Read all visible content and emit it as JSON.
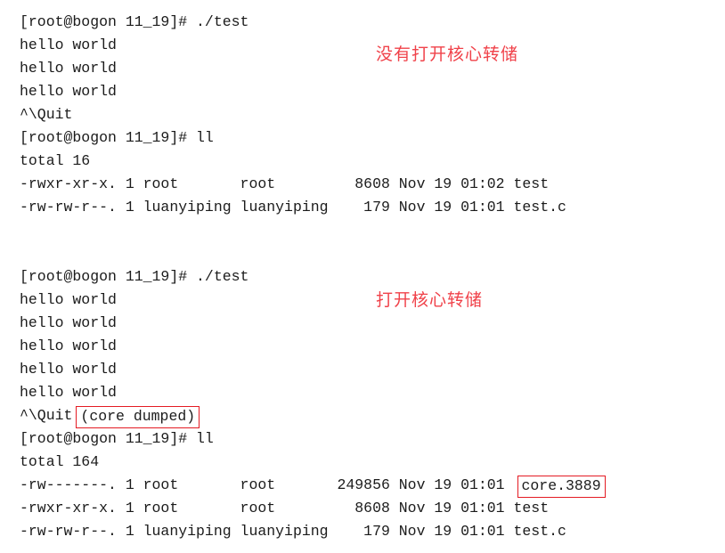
{
  "terminal": {
    "prompt": "[root@bogon 11_19]# ",
    "blocks": [
      {
        "id": "without-core-dump",
        "lines": [
          {
            "type": "prompt",
            "text": "[root@bogon 11_19]# ./test"
          },
          {
            "type": "output",
            "text": "hello world"
          },
          {
            "type": "output",
            "text": "hello world"
          },
          {
            "type": "output",
            "text": "hello world"
          },
          {
            "type": "signal",
            "text": "^\\Quit"
          },
          {
            "type": "prompt",
            "text": "[root@bogon 11_19]# ll"
          },
          {
            "type": "output",
            "text": "total 16"
          },
          {
            "type": "listing",
            "text": "-rwxr-xr-x. 1 root       root         8608 Nov 19 01:02 test"
          },
          {
            "type": "listing",
            "text": "-rw-rw-r--. 1 luanyiping luanyiping    179 Nov 19 01:01 test.c"
          },
          {
            "type": "blank",
            "text": ""
          },
          {
            "type": "blank",
            "text": ""
          }
        ]
      },
      {
        "id": "with-core-dump",
        "lines": [
          {
            "type": "prompt",
            "text": "[root@bogon 11_19]# ./test"
          },
          {
            "type": "output",
            "text": "hello world"
          },
          {
            "type": "output",
            "text": "hello world"
          },
          {
            "type": "output",
            "text": "hello world"
          },
          {
            "type": "output",
            "text": "hello world"
          },
          {
            "type": "output",
            "text": "hello world"
          },
          {
            "type": "signal_boxed",
            "text": "^\\Quit",
            "boxed": "(core dumped)"
          },
          {
            "type": "prompt",
            "text": "[root@bogon 11_19]# ll"
          },
          {
            "type": "output",
            "text": "total 164"
          },
          {
            "type": "listing_boxed",
            "text": "-rw-------. 1 root       root       249856 Nov 19 01:01 ",
            "boxed": "core.3889"
          },
          {
            "type": "listing",
            "text": "-rwxr-xr-x. 1 root       root         8608 Nov 19 01:01 test"
          },
          {
            "type": "listing",
            "text": "-rw-rw-r--. 1 luanyiping luanyiping    179 Nov 19 01:01 test.c"
          }
        ]
      }
    ]
  },
  "annotations": {
    "no_core_dump": "没有打开核心转储",
    "core_dump_on": "打开核心转储"
  },
  "colors": {
    "annotation_red": "#f0424a",
    "box_red": "#e41b23",
    "text": "#1b1b1b",
    "background": "#ffffff"
  }
}
